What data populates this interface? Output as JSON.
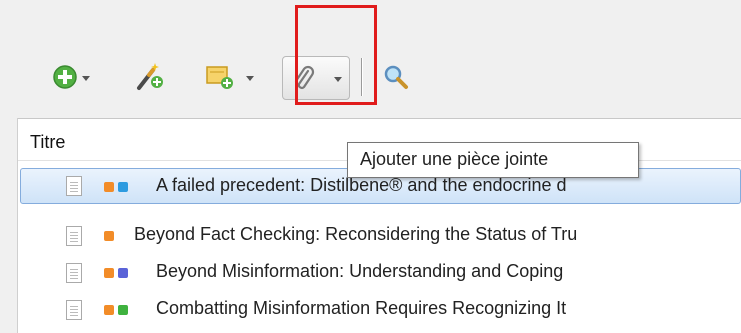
{
  "toolbar": {
    "buttons": [
      {
        "icon": "new-item-icon"
      },
      {
        "icon": "add-by-identifier-icon"
      },
      {
        "icon": "new-note-icon"
      },
      {
        "icon": "attachment-icon"
      },
      {
        "icon": "search-icon"
      }
    ]
  },
  "tooltip": {
    "text": "Ajouter une pièce jointe"
  },
  "table": {
    "column_header": "Titre",
    "rows": [
      {
        "title": "A failed precedent: Distilbene® and the endocrine d",
        "tags": [
          "#f28c28",
          "#2d9be0"
        ],
        "selected": true
      },
      {
        "title": "Beyond Fact Checking: Reconsidering the Status of Tru",
        "tags": [
          "#f28c28"
        ],
        "selected": false
      },
      {
        "title": "Beyond Misinformation: Understanding and Coping",
        "tags": [
          "#f28c28",
          "#5a63d8"
        ],
        "selected": false
      },
      {
        "title": "Combatting Misinformation Requires Recognizing It",
        "tags": [
          "#f28c28",
          "#3fb23f"
        ],
        "selected": false
      }
    ]
  },
  "colors": {
    "highlight": "#e01b1b",
    "selection": "#cfe3f8",
    "tag_orange": "#f28c28",
    "tag_blue": "#2d9be0",
    "tag_purple": "#5a63d8",
    "tag_green": "#3fb23f"
  }
}
